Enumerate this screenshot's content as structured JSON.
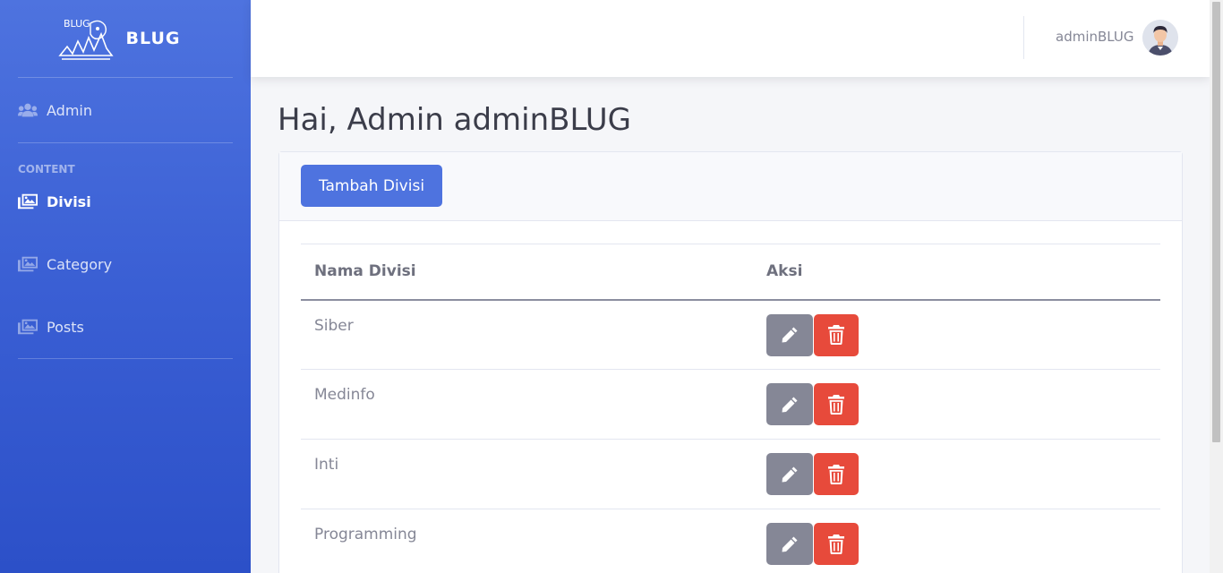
{
  "brand": {
    "name": "BLUG",
    "logo_text": "BLUG"
  },
  "sidebar": {
    "admin_label": "Admin",
    "heading": "CONTENT",
    "items": [
      {
        "label": "Divisi",
        "icon": "images-icon",
        "active": true
      },
      {
        "label": "Category",
        "icon": "images-icon",
        "active": false
      },
      {
        "label": "Posts",
        "icon": "images-icon",
        "active": false
      }
    ]
  },
  "topbar": {
    "user_name": "adminBLUG"
  },
  "main": {
    "title": "Hai, Admin adminBLUG",
    "add_button": "Tambah Divisi",
    "table": {
      "headers": [
        "Nama Divisi",
        "Aksi"
      ],
      "rows": [
        "Siber",
        "Medinfo",
        "Inti",
        "Programming"
      ]
    }
  },
  "colors": {
    "primary": "#4e73df",
    "danger": "#e74a3b",
    "secondary": "#858796"
  }
}
